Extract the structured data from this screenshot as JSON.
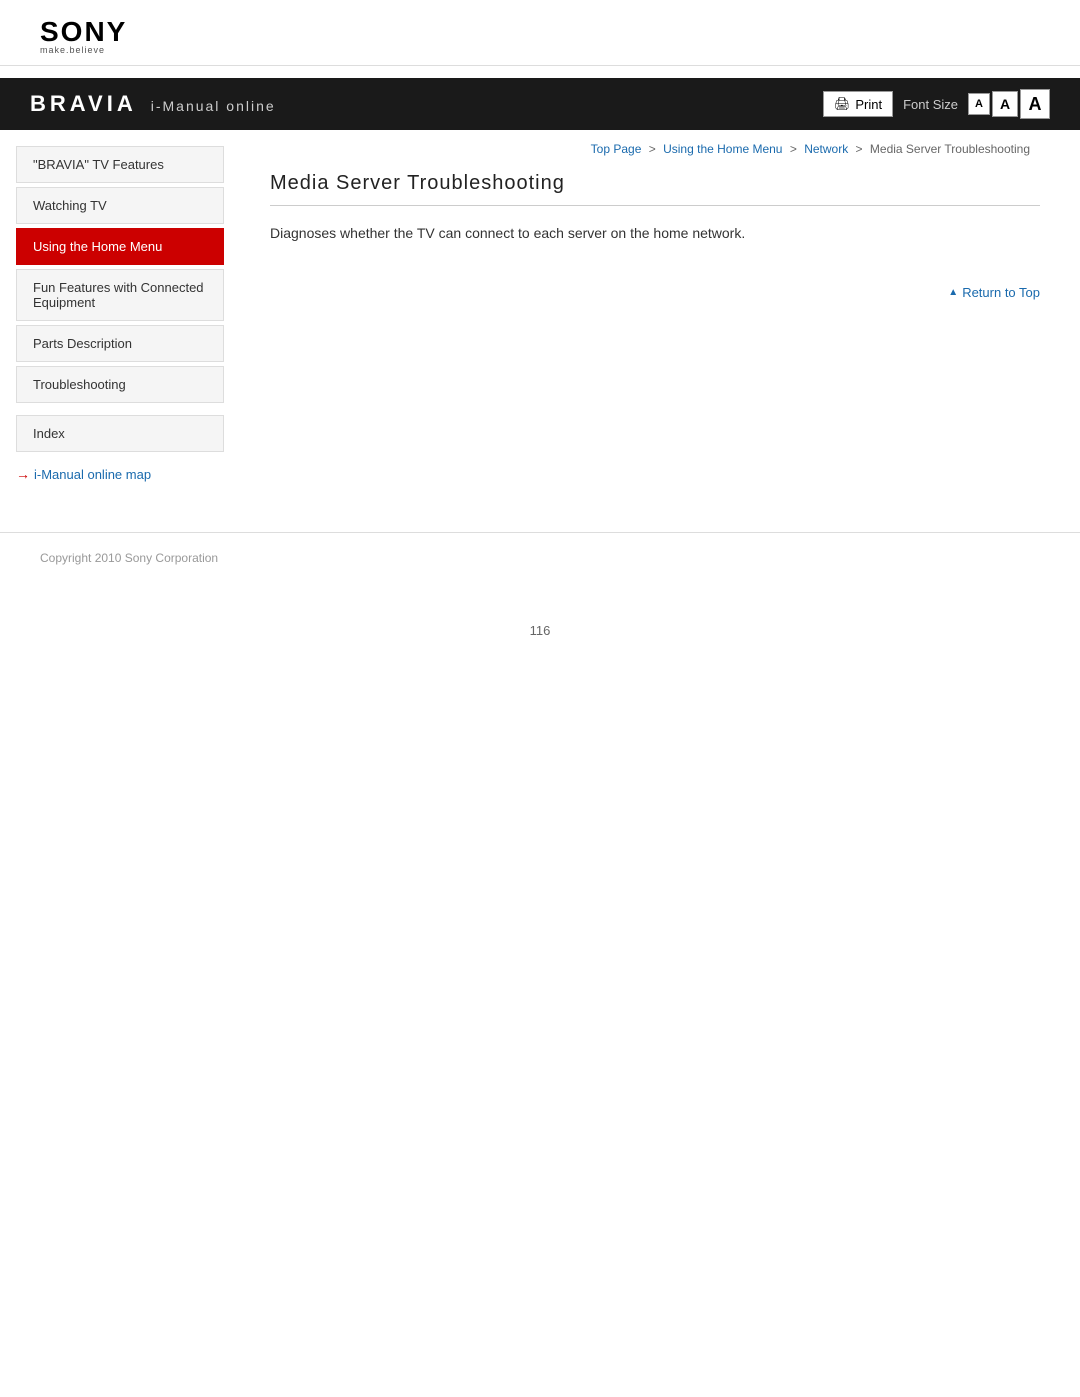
{
  "logo": {
    "brand": "SONY",
    "tagline": "make.believe"
  },
  "banner": {
    "bravia": "BRAVIA",
    "imanual": "i-Manual online",
    "print_label": "Print",
    "font_size_label": "Font Size",
    "font_small": "A",
    "font_medium": "A",
    "font_large": "A"
  },
  "breadcrumb": {
    "top_page": "Top Page",
    "separator1": ">",
    "using_home_menu": "Using the Home Menu",
    "separator2": ">",
    "network": "Network",
    "separator3": ">",
    "current": "Media Server Troubleshooting"
  },
  "sidebar": {
    "items": [
      {
        "id": "bravia-tv-features",
        "label": "\"BRAVIA\" TV Features",
        "active": false
      },
      {
        "id": "watching-tv",
        "label": "Watching TV",
        "active": false
      },
      {
        "id": "using-home-menu",
        "label": "Using the Home Menu",
        "active": true
      },
      {
        "id": "fun-features",
        "label": "Fun Features with Connected Equipment",
        "active": false
      },
      {
        "id": "parts-description",
        "label": "Parts Description",
        "active": false
      },
      {
        "id": "troubleshooting",
        "label": "Troubleshooting",
        "active": false
      }
    ],
    "index_label": "Index",
    "map_link": "i-Manual online map"
  },
  "main": {
    "title": "Media Server Troubleshooting",
    "description": "Diagnoses whether the TV can connect to each server on the home network."
  },
  "return_top": {
    "label": "Return to Top"
  },
  "footer": {
    "copyright": "Copyright 2010 Sony Corporation"
  },
  "page_number": "116"
}
